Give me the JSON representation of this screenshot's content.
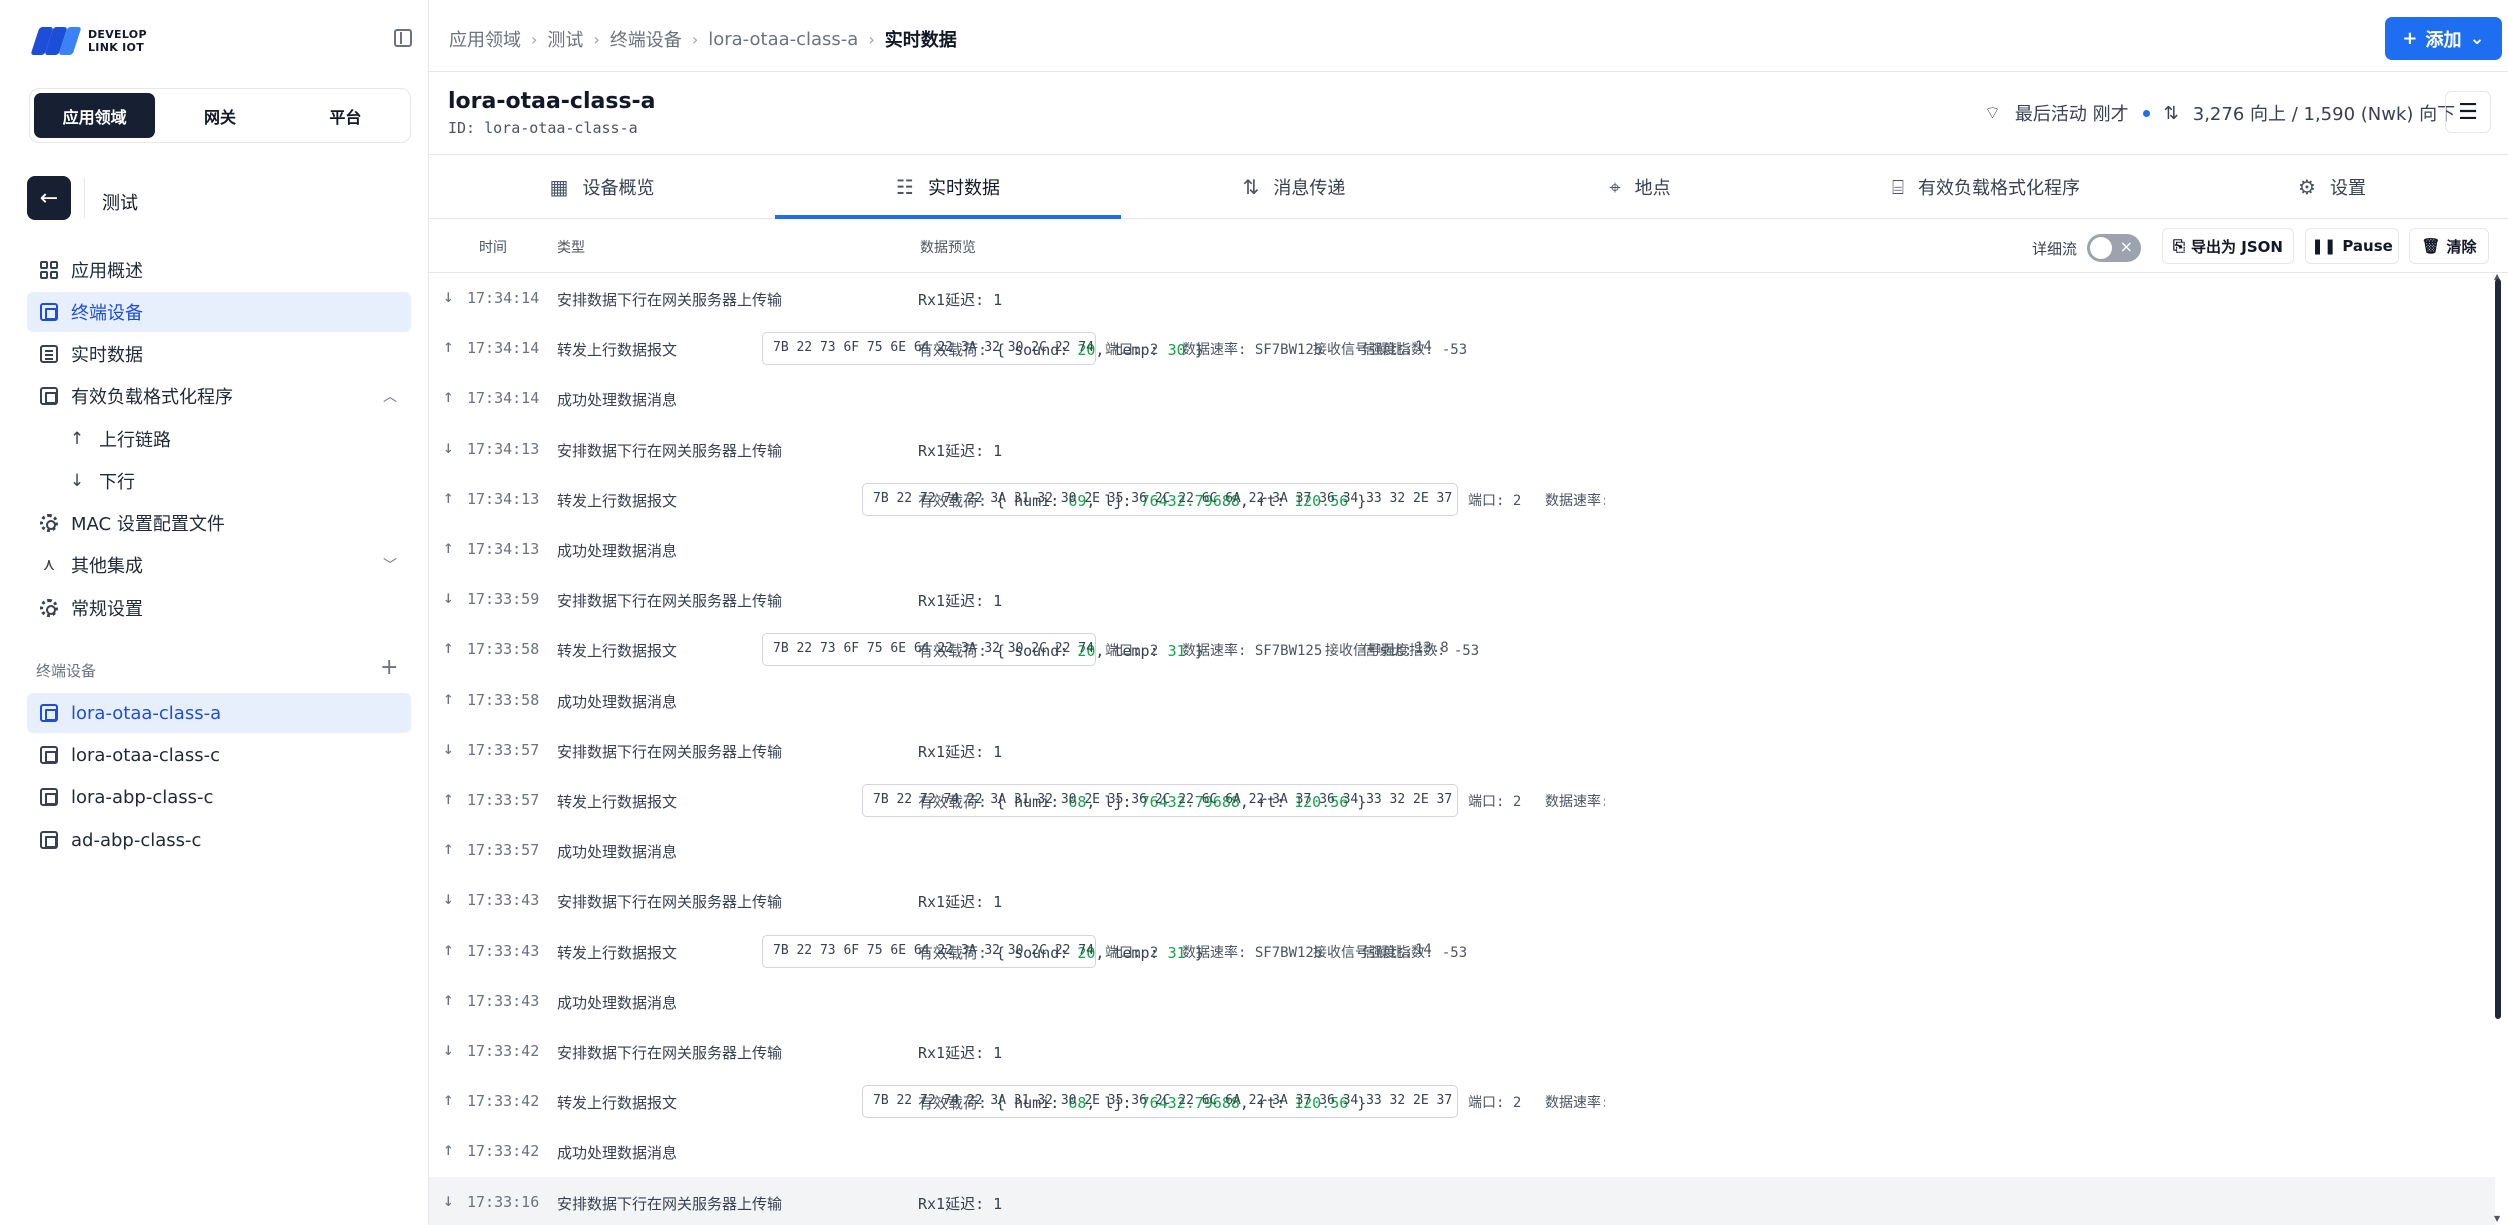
{
  "logo": {
    "line1": "DEVELOP",
    "line2": "LINK IOT"
  },
  "segments": [
    "应用领域",
    "网关",
    "平台"
  ],
  "app_name": "测试",
  "nav": [
    {
      "label": "应用概述",
      "icon": "grid-icon"
    },
    {
      "label": "终端设备",
      "icon": "chip-icon"
    },
    {
      "label": "实时数据",
      "icon": "list-icon"
    },
    {
      "label": "有效负载格式化程序",
      "icon": "code-icon"
    },
    {
      "label": "上行链路",
      "icon": "arrow-up-icon"
    },
    {
      "label": "下行",
      "icon": "arrow-down-icon"
    },
    {
      "label": "MAC 设置配置文件",
      "icon": "gear-icon"
    },
    {
      "label": "其他集成",
      "icon": "integration-icon"
    },
    {
      "label": "常规设置",
      "icon": "gear-icon"
    }
  ],
  "devices_section": "终端设备",
  "devices": [
    "lora-otaa-class-a",
    "lora-otaa-class-c",
    "lora-abp-class-c",
    "ad-abp-class-c"
  ],
  "breadcrumb": [
    "应用领域",
    "测试",
    "终端设备",
    "lora-otaa-class-a",
    "实时数据"
  ],
  "add_button": "添加",
  "device": {
    "title": "lora-otaa-class-a",
    "id": "ID: lora-otaa-class-a",
    "last_activity": "最后活动 刚才",
    "traffic": "3,276 向上 / 1,590 (Nwk) 向下"
  },
  "tabs": [
    {
      "label": "设备概览",
      "icon": "overview-icon"
    },
    {
      "label": "实时数据",
      "icon": "list-icon"
    },
    {
      "label": "消息传递",
      "icon": "updown-icon"
    },
    {
      "label": "地点",
      "icon": "pin-icon"
    },
    {
      "label": "有效负载格式化程序",
      "icon": "code-icon"
    },
    {
      "label": "设置",
      "icon": "gear-icon"
    }
  ],
  "columns": {
    "time": "时间",
    "type": "类型",
    "preview": "数据预览"
  },
  "toolbar": {
    "verbose": "详细流",
    "export": "导出为 JSON",
    "pause": "Pause",
    "clear": "清除"
  },
  "labels": {
    "rx1": "Rx1延迟: 1",
    "payload": "有效载荷:",
    "port": "端口: 2",
    "rate": "数据速率: SF7BW125",
    "snr": "信噪比:",
    "rssi": "接收信号强度指数: -53"
  },
  "events": [
    {
      "time": "17:34:14",
      "dir": "down",
      "type": "安排数据下行在网关服务器上传输",
      "kind": "rx"
    },
    {
      "time": "17:34:14",
      "dir": "up",
      "type": "转发上行数据报文",
      "kind": "sound",
      "p1": "20",
      "p2": "30",
      "hex": "7B 22 73 6F 75 6E 64 22 3A 32 30 2C 22 74 65 6D 70 22 3A 33 30 7D…",
      "snr": "14"
    },
    {
      "time": "17:34:14",
      "dir": "up",
      "type": "成功处理数据消息",
      "kind": "none"
    },
    {
      "time": "17:34:13",
      "dir": "down",
      "type": "安排数据下行在网关服务器上传输",
      "kind": "rx"
    },
    {
      "time": "17:34:13",
      "dir": "up",
      "type": "转发上行数据报文",
      "kind": "humi",
      "p1": "69",
      "p2": "76432.79688",
      "p3": "120.56",
      "hex": "7B 22 72 74 22 3A 31 32 30 2E 35 36 2C 22 6C 6A 22 3A 37 36 34 33 32 2E 37 39 36 38 38 2C 22 68 75 6D 69 22 3A 36 39 7D…"
    },
    {
      "time": "17:34:13",
      "dir": "up",
      "type": "成功处理数据消息",
      "kind": "none"
    },
    {
      "time": "17:33:59",
      "dir": "down",
      "type": "安排数据下行在网关服务器上传输",
      "kind": "rx"
    },
    {
      "time": "17:33:58",
      "dir": "up",
      "type": "转发上行数据报文",
      "kind": "sound",
      "p1": "20",
      "p2": "31",
      "hex": "7B 22 73 6F 75 6E 64 22 3A 32 30 2C 22 74 65 6D 70 22 3A 33 31 7D…",
      "snr": "13.8"
    },
    {
      "time": "17:33:58",
      "dir": "up",
      "type": "成功处理数据消息",
      "kind": "none"
    },
    {
      "time": "17:33:57",
      "dir": "down",
      "type": "安排数据下行在网关服务器上传输",
      "kind": "rx"
    },
    {
      "time": "17:33:57",
      "dir": "up",
      "type": "转发上行数据报文",
      "kind": "humi",
      "p1": "68",
      "p2": "76432.79688",
      "p3": "120.56",
      "hex": "7B 22 72 74 22 3A 31 32 30 2E 35 36 2C 22 6C 6A 22 3A 37 36 34 33 32 2E 37 39 36 38 38 2C 22 68 75 6D 69 22 3A 36 38 7D…"
    },
    {
      "time": "17:33:57",
      "dir": "up",
      "type": "成功处理数据消息",
      "kind": "none"
    },
    {
      "time": "17:33:43",
      "dir": "down",
      "type": "安排数据下行在网关服务器上传输",
      "kind": "rx"
    },
    {
      "time": "17:33:43",
      "dir": "up",
      "type": "转发上行数据报文",
      "kind": "sound",
      "p1": "20",
      "p2": "31",
      "hex": "7B 22 73 6F 75 6E 64 22 3A 32 30 2C 22 74 65 6D 70 22 3A 33 31 7D…",
      "snr": "14"
    },
    {
      "time": "17:33:43",
      "dir": "up",
      "type": "成功处理数据消息",
      "kind": "none"
    },
    {
      "time": "17:33:42",
      "dir": "down",
      "type": "安排数据下行在网关服务器上传输",
      "kind": "rx"
    },
    {
      "time": "17:33:42",
      "dir": "up",
      "type": "转发上行数据报文",
      "kind": "humi",
      "p1": "68",
      "p2": "76432.79688",
      "p3": "120.56",
      "hex": "7B 22 72 74 22 3A 31 32 30 2E 35 36 2C 22 6C 6A 22 3A 37 36 34 33 32 2E 37 39 36 38 38 2C 22 68 75 6D 69 22 3A 36 38 7D…"
    },
    {
      "time": "17:33:42",
      "dir": "up",
      "type": "成功处理数据消息",
      "kind": "none"
    },
    {
      "time": "17:33:16",
      "dir": "down",
      "type": "安排数据下行在网关服务器上传输",
      "kind": "rx",
      "highlight": true
    }
  ],
  "colors": {
    "accent": "#1d6ef0",
    "dark": "#172033",
    "value_green": "#16a34a",
    "active_bg": "#e8effc"
  }
}
